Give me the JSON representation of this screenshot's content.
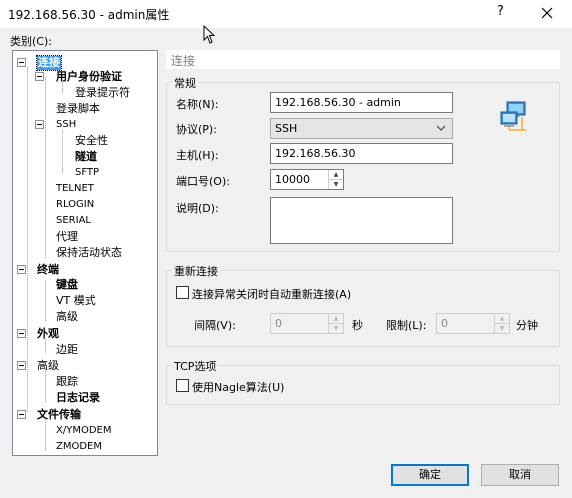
{
  "window": {
    "title": "192.168.56.30 - admin属性",
    "help_glyph": "?",
    "close_icon": "close-icon"
  },
  "category": {
    "label": "类别(C):",
    "tree": [
      {
        "label": "连接",
        "bold": true,
        "selected": true
      },
      {
        "label": "用户身份验证",
        "bold": true
      },
      {
        "label": "登录提示符"
      },
      {
        "label": "登录脚本"
      },
      {
        "label": "SSH",
        "small": true
      },
      {
        "label": "安全性"
      },
      {
        "label": "隧道",
        "bold": true
      },
      {
        "label": "SFTP",
        "small": true
      },
      {
        "label": "TELNET",
        "small": true
      },
      {
        "label": "RLOGIN",
        "small": true
      },
      {
        "label": "SERIAL",
        "small": true
      },
      {
        "label": "代理"
      },
      {
        "label": "保持活动状态"
      },
      {
        "label": "终端",
        "bold": true
      },
      {
        "label": "键盘",
        "bold": true
      },
      {
        "label": "VT 模式"
      },
      {
        "label": "高级"
      },
      {
        "label": "外观",
        "bold": true
      },
      {
        "label": "边距"
      },
      {
        "label": "高级"
      },
      {
        "label": "跟踪"
      },
      {
        "label": "日志记录",
        "bold": true
      },
      {
        "label": "文件传输",
        "bold": true
      },
      {
        "label": "X/YMODEM",
        "small": true
      },
      {
        "label": "ZMODEM",
        "small": true
      }
    ]
  },
  "panel": {
    "header": "连接",
    "general": {
      "title": "常规",
      "name_label": "名称(N):",
      "name_value": "192.168.56.30 - admin",
      "protocol_label": "协议(P):",
      "protocol_value": "SSH",
      "host_label": "主机(H):",
      "host_value": "192.168.56.30",
      "port_label": "端口号(O):",
      "port_value": "10000",
      "description_label": "说明(D):",
      "description_value": "",
      "icon": "network-computers-icon"
    },
    "reconnect": {
      "title": "重新连接",
      "auto_reconnect_label": "连接异常关闭时自动重新连接(A)",
      "auto_reconnect_checked": false,
      "interval_label": "间隔(V):",
      "interval_value": "0",
      "interval_unit": "秒",
      "limit_label": "限制(L):",
      "limit_value": "0",
      "limit_unit": "分钟"
    },
    "tcp": {
      "title": "TCP选项",
      "nagle_label": "使用Nagle算法(U)",
      "nagle_checked": false
    }
  },
  "buttons": {
    "ok": "确定",
    "cancel": "取消"
  }
}
